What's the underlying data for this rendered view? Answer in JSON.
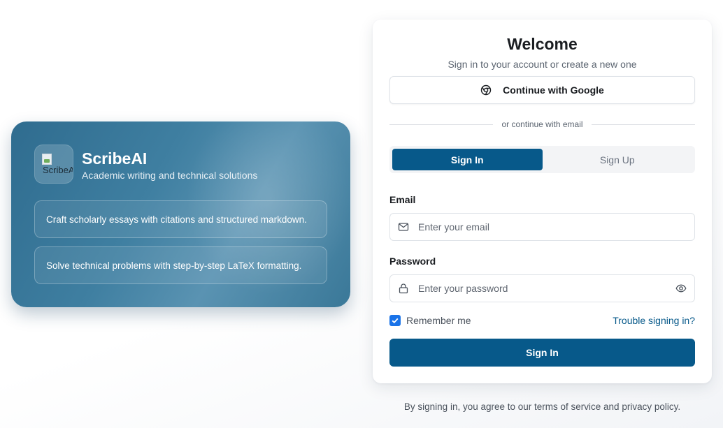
{
  "brand": {
    "logo_alt": "ScribeAI",
    "name": "ScribeAI",
    "tagline": "Academic writing and technical solutions",
    "features": [
      "Craft scholarly essays with citations and structured markdown.",
      "Solve technical problems with step-by-step LaTeX formatting."
    ]
  },
  "auth": {
    "title": "Welcome",
    "subtitle": "Sign in to your account or create a new one",
    "google_label": "Continue with Google",
    "divider_text": "or continue with email",
    "tabs": [
      {
        "label": "Sign In",
        "active": true
      },
      {
        "label": "Sign Up",
        "active": false
      }
    ],
    "email": {
      "label": "Email",
      "placeholder": "Enter your email",
      "value": ""
    },
    "password": {
      "label": "Password",
      "placeholder": "Enter your password",
      "value": ""
    },
    "remember_label": "Remember me",
    "remember_checked": true,
    "trouble_label": "Trouble signing in?",
    "submit_label": "Sign In"
  },
  "footer": {
    "terms": "By signing in, you agree to our terms of service and privacy policy."
  },
  "colors": {
    "primary": "#07598a",
    "checkbox": "#1a73e8",
    "brand_card": "#3f7fa1"
  },
  "icons": {
    "google": "chrome-icon",
    "email": "mail-icon",
    "password": "lock-icon",
    "toggle": "eye-icon",
    "check": "check-icon"
  }
}
